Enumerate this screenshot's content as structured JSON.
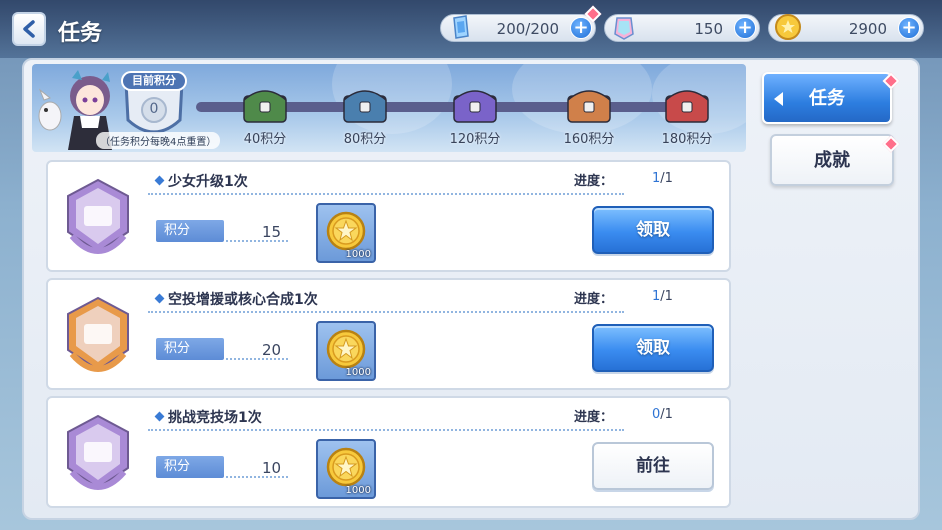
{
  "header": {
    "title": "任务",
    "back_icon": "chevron-left-icon"
  },
  "resources": {
    "stamina": {
      "icon": "stamina-crystal-icon",
      "value": "200/200"
    },
    "gems": {
      "icon": "gem-icon",
      "value": "150"
    },
    "coins": {
      "icon": "coin-icon",
      "value": "2900"
    }
  },
  "banner": {
    "score_label": "目前积分",
    "score_value": "0",
    "reset_note": "（任务积分每晚4点重置）",
    "milestones": [
      {
        "label": "40积分",
        "color": "#4f8a4a"
      },
      {
        "label": "80积分",
        "color": "#4a7fae"
      },
      {
        "label": "120积分",
        "color": "#7a63c9"
      },
      {
        "label": "160积分",
        "color": "#d0804a"
      },
      {
        "label": "180积分",
        "color": "#c84a4a"
      }
    ]
  },
  "quests": [
    {
      "title": "少女升级1次",
      "progress_label": "进度：",
      "progress_current": "1",
      "progress_total": "/1",
      "points_label": "积分",
      "points": "15",
      "reward_qty": "1000",
      "button": "领取",
      "button_type": "claim",
      "emblem_color": "#a98ad6"
    },
    {
      "title": "空投增援或核心合成1次",
      "progress_label": "进度：",
      "progress_current": "1",
      "progress_total": "/1",
      "points_label": "积分",
      "points": "20",
      "reward_qty": "1000",
      "button": "领取",
      "button_type": "claim",
      "emblem_color": "#e89a4a"
    },
    {
      "title": "挑战竞技场1次",
      "progress_label": "进度：",
      "progress_current": "0",
      "progress_total": "/1",
      "points_label": "积分",
      "points": "10",
      "reward_qty": "1000",
      "button": "前往",
      "button_type": "go",
      "emblem_color": "#a98ad6"
    }
  ],
  "tabs": {
    "active": "任务",
    "inactive": "成就"
  },
  "colors": {
    "accent_blue": "#2d7ee0",
    "notify_red": "#ff6e8a"
  }
}
